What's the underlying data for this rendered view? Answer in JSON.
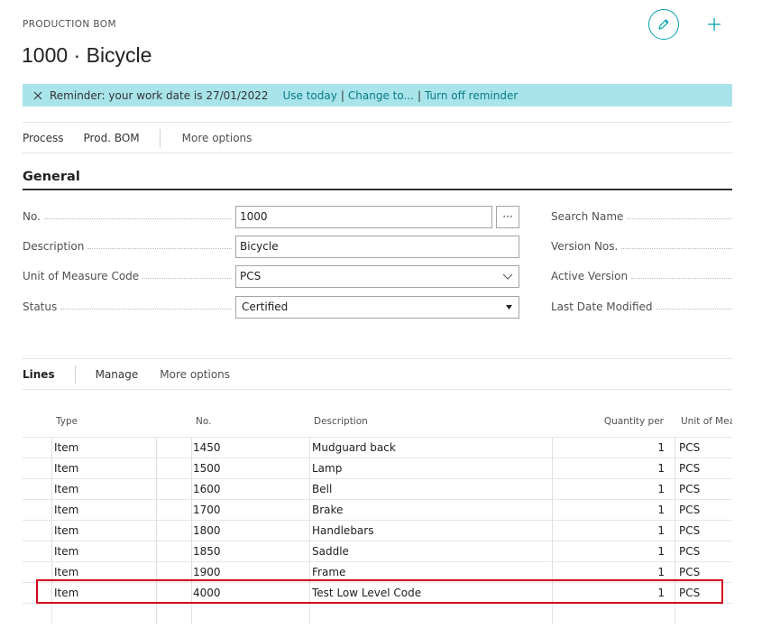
{
  "header": {
    "caption": "PRODUCTION BOM",
    "title": "1000 · Bicycle"
  },
  "banner": {
    "text": "Reminder: your work date is 27/01/2022",
    "use_today": "Use today",
    "change_to": "Change to...",
    "turn_off": "Turn off reminder",
    "separator": "|"
  },
  "actionbar": {
    "process": "Process",
    "prod_bom": "Prod. BOM",
    "more": "More options"
  },
  "general": {
    "title": "General",
    "no_label": "No.",
    "no_value": "1000",
    "ellipsis": "···",
    "description_label": "Description",
    "description_value": "Bicycle",
    "uom_label": "Unit of Measure Code",
    "uom_value": "PCS",
    "status_label": "Status",
    "status_value": "Certified",
    "search_name_label": "Search Name",
    "version_nos_label": "Version Nos.",
    "active_version_label": "Active Version",
    "last_modified_label": "Last Date Modified"
  },
  "lines": {
    "title": "Lines",
    "manage": "Manage",
    "more": "More options",
    "columns": {
      "type": "Type",
      "no": "No.",
      "description": "Description",
      "qty": "Quantity per",
      "uom": "Unit of Meas"
    },
    "rows": [
      {
        "type": "Item",
        "no": "1450",
        "description": "Mudguard back",
        "qty": "1",
        "uom": "PCS"
      },
      {
        "type": "Item",
        "no": "1500",
        "description": "Lamp",
        "qty": "1",
        "uom": "PCS"
      },
      {
        "type": "Item",
        "no": "1600",
        "description": "Bell",
        "qty": "1",
        "uom": "PCS"
      },
      {
        "type": "Item",
        "no": "1700",
        "description": "Brake",
        "qty": "1",
        "uom": "PCS"
      },
      {
        "type": "Item",
        "no": "1800",
        "description": "Handlebars",
        "qty": "1",
        "uom": "PCS"
      },
      {
        "type": "Item",
        "no": "1850",
        "description": "Saddle",
        "qty": "1",
        "uom": "PCS"
      },
      {
        "type": "Item",
        "no": "1900",
        "description": "Frame",
        "qty": "1",
        "uom": "PCS"
      },
      {
        "type": "Item",
        "no": "4000",
        "description": "Test Low Level Code",
        "qty": "1",
        "uom": "PCS"
      }
    ]
  },
  "icons": {
    "edit": "pencil-icon",
    "new": "plus-icon",
    "close": "close-icon",
    "dropdown": "chevron-down-icon",
    "select": "caret-down-icon"
  },
  "colors": {
    "accent": "#00a1ad",
    "banner_bg": "#a8e4ea",
    "highlight": "#d0021b"
  }
}
